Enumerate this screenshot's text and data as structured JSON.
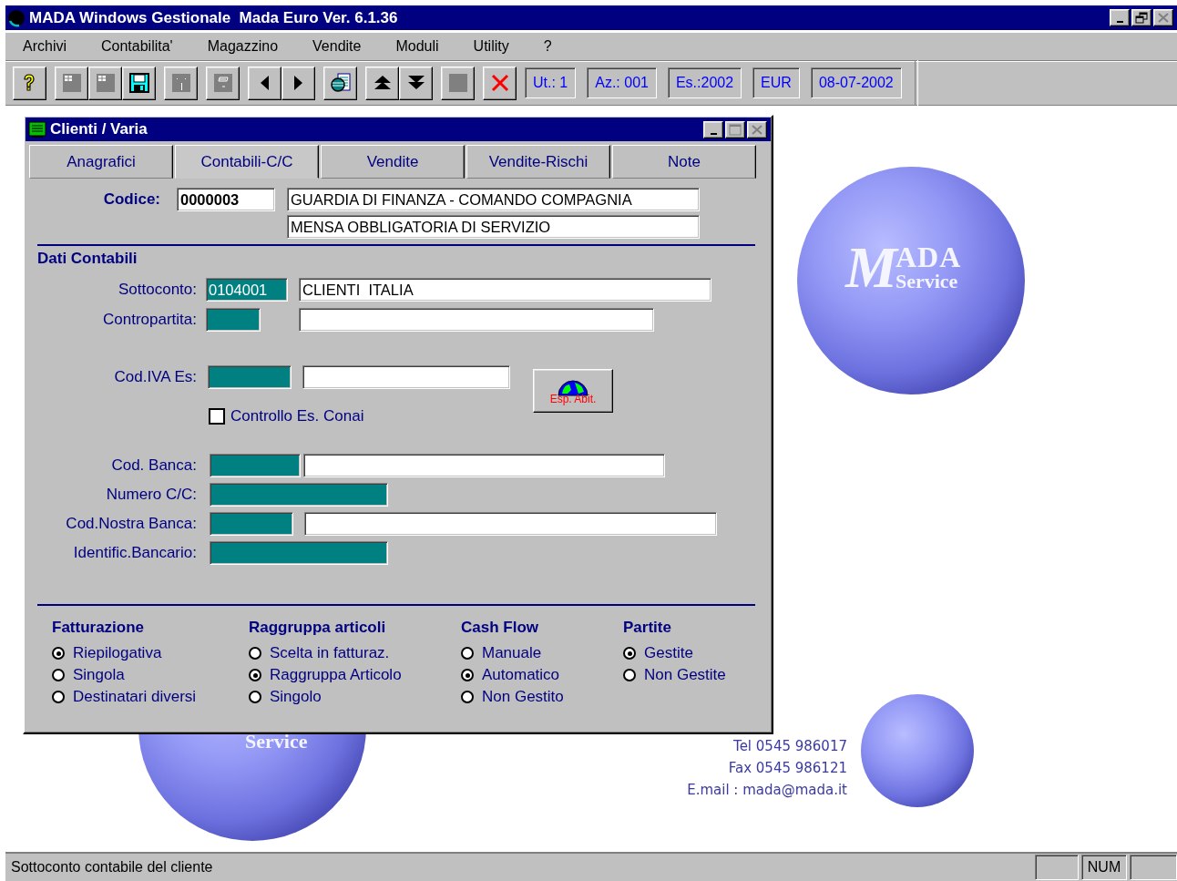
{
  "window": {
    "title": "MADA Windows Gestionale  Mada Euro Ver. 6.1.36"
  },
  "menu": [
    {
      "label": "Archivi"
    },
    {
      "label": "Contabilita'"
    },
    {
      "label": "Magazzino"
    },
    {
      "label": "Vendite"
    },
    {
      "label": "Moduli"
    },
    {
      "label": "Utility"
    },
    {
      "label": "?"
    }
  ],
  "toolbar": {
    "groups": [
      [
        {
          "kind": "help"
        }
      ],
      [
        {
          "kind": "grid"
        },
        {
          "kind": "grid"
        },
        {
          "kind": "save"
        }
      ],
      [
        {
          "kind": "dots"
        }
      ],
      [
        {
          "kind": "note"
        }
      ],
      [
        {
          "kind": "prev"
        },
        {
          "kind": "next"
        }
      ],
      [
        {
          "kind": "print"
        }
      ],
      [
        {
          "kind": "up"
        },
        {
          "kind": "down"
        }
      ],
      [
        {
          "kind": "blank"
        }
      ],
      [
        {
          "kind": "delete"
        }
      ]
    ],
    "fields": [
      "Ut.: 1",
      "Az.: 001",
      "Es.:2002",
      "EUR",
      "08-07-2002"
    ]
  },
  "child_window": {
    "title": "Clienti / Varia",
    "tabs": [
      {
        "label": "Anagrafici",
        "selected": false
      },
      {
        "label": "Contabili-C/C",
        "selected": true
      },
      {
        "label": "Vendite",
        "selected": false
      },
      {
        "label": "Vendite-Rischi",
        "selected": false
      },
      {
        "label": "Note",
        "selected": false
      }
    ],
    "codice": {
      "label": "Codice:",
      "value": "0000003",
      "name_lines": [
        "GUARDIA DI FINANZA - COMANDO COMPAGNIA",
        "MENSA OBBLIGATORIA DI SERVIZIO"
      ]
    },
    "section_title": "Dati Contabili",
    "fields": [
      {
        "kind": "pair",
        "label": "Sottoconto:",
        "code": "0104001",
        "description": "CLIENTI  ITALIA"
      },
      {
        "kind": "pair",
        "label": "Contropartita:"
      },
      {
        "kind": "pair",
        "label": "Cod.IVA Es:",
        "button": "Esp. Abit."
      },
      {
        "kind": "checkbox",
        "label": "Controllo Es. Conai",
        "checked": false
      },
      {
        "kind": "pair",
        "label": "Cod. Banca:"
      },
      {
        "kind": "code",
        "label": "Numero C/C:"
      },
      {
        "kind": "pair",
        "label": "Cod.Nostra Banca:"
      },
      {
        "kind": "code",
        "label": "Identific.Bancario:"
      }
    ],
    "radio_groups": [
      {
        "title": "Fatturazione",
        "options": [
          {
            "label": "Riepilogativa",
            "selected": true
          },
          {
            "label": "Singola",
            "selected": false
          },
          {
            "label": "Destinatari diversi",
            "selected": false
          }
        ]
      },
      {
        "title": "Raggruppa articoli",
        "options": [
          {
            "label": "Scelta in fatturaz.",
            "selected": false
          },
          {
            "label": "Raggruppa Articolo",
            "selected": true
          },
          {
            "label": "Singolo",
            "selected": false
          }
        ]
      },
      {
        "title": "Cash Flow",
        "options": [
          {
            "label": "Manuale",
            "selected": false
          },
          {
            "label": "Automatico",
            "selected": true
          },
          {
            "label": "Non Gestito",
            "selected": false
          }
        ]
      },
      {
        "title": "Partite",
        "options": [
          {
            "label": "Gestite",
            "selected": true
          },
          {
            "label": "Non Gestite",
            "selected": false
          }
        ]
      }
    ]
  },
  "background": {
    "logo": {
      "initial": "M",
      "rest": "ADA",
      "sub": "Service"
    },
    "lower_logo_sub": "Service",
    "contact": [
      "Tel 0545 986017",
      "Fax 0545 986121",
      "E.mail : mada@mada.it"
    ]
  },
  "status_bar": {
    "text": "Sottoconto contabile del cliente",
    "panels": [
      {
        "kind": "empty"
      },
      {
        "kind": "text",
        "text": "NUM"
      },
      {
        "kind": "empty"
      }
    ]
  }
}
